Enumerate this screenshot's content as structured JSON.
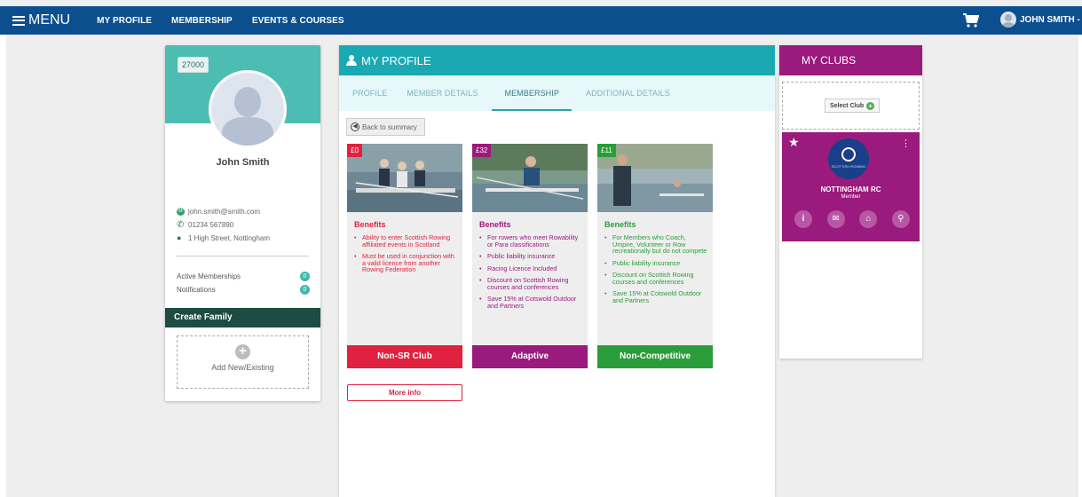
{
  "nav": {
    "menu_label": "MENU",
    "links": [
      "MY PROFILE",
      "MEMBERSHIP",
      "EVENTS & COURSES"
    ],
    "user_name": "JOHN SMITH"
  },
  "profile": {
    "member_id": "27000",
    "name": "John Smith",
    "email": "john.smith@smith.com",
    "phone": "01234 567890",
    "address": "1 High Street, Nottingham",
    "stats": [
      {
        "label": "Active Memberships",
        "value": "0"
      },
      {
        "label": "Notifications",
        "value": "0"
      }
    ],
    "create_family": "Create Family",
    "add_label": "Add New/Existing"
  },
  "main": {
    "title": "MY PROFILE",
    "tabs": [
      "PROFILE",
      "MEMBER DETAILS",
      "MEMBERSHIP",
      "ADDITIONAL DETAILS"
    ],
    "active_tab": "MEMBERSHIP",
    "back_label": "Back to summary",
    "cards": [
      {
        "price": "£0",
        "benefits_title": "Benefits",
        "benefits": [
          "Ability to enter Scottish Rowing affiliated events in Scotland",
          "Must be used in conjunction with a valid licence from another Rowing Federation"
        ],
        "footer": "Non-SR Club",
        "color": "#e0213f"
      },
      {
        "price": "£32",
        "benefits_title": "Benefits",
        "benefits": [
          "For rowers who meet Rowability or Para classifications",
          "Public liability insurance",
          "Racing Licence Included",
          "Discount on Scottish Rowing courses and conferences",
          "Save 15% at Cotswold Outdoor and Partners"
        ],
        "footer": "Adaptive",
        "color": "#9a1a7d"
      },
      {
        "price": "£11",
        "benefits_title": "Benefits",
        "benefits": [
          "For Members who Coach, Umpire, Volunteer or Row recreationally but do not compete",
          "Public liability insurance",
          "Discount on Scottish Rowing courses and conferences",
          "Save 15% at Cotswold Outdoor and Partners"
        ],
        "footer": "Non-Competitive",
        "color": "#2a9d3a"
      }
    ],
    "more_info": "More info"
  },
  "clubs": {
    "title": "MY CLUBS",
    "select_label": "Select Club",
    "club_name": "NOTTINGHAM RC",
    "club_role": "Member",
    "logo_text": "SCOTTISH ROWING"
  }
}
